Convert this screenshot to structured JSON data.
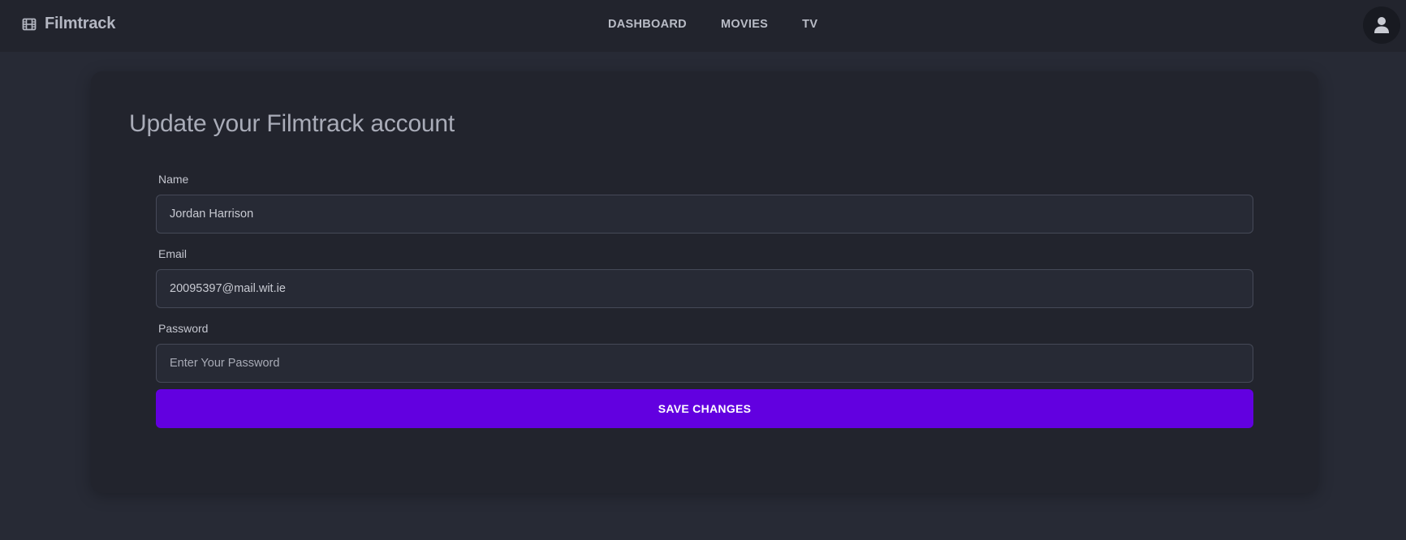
{
  "header": {
    "brand_icon": "film-icon",
    "brand_name": "Filmtrack",
    "nav": [
      "DASHBOARD",
      "MOVIES",
      "TV"
    ],
    "avatar_icon": "user-icon"
  },
  "form": {
    "title": "Update your Filmtrack account",
    "name_label": "Name",
    "name_value": "Jordan Harrison",
    "email_label": "Email",
    "email_value": "20095397@mail.wit.ie",
    "password_label": "Password",
    "password_placeholder": "Enter Your Password",
    "save_label": "SAVE CHANGES"
  },
  "colors": {
    "accent": "#6200e0",
    "background": "#272a35",
    "surface": "#22242d"
  }
}
